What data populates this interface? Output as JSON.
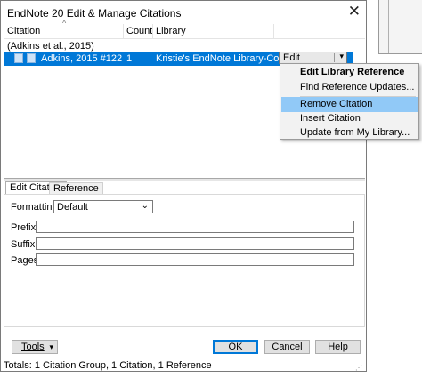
{
  "window": {
    "title": "EndNote 20 Edit & Manage Citations",
    "close_glyph": "✕"
  },
  "list": {
    "columns": [
      "Citation",
      "Count",
      "Library"
    ],
    "group_label": "(Adkins et al., 2015)",
    "rows": [
      {
        "citation": "Adkins, 2015 #122",
        "count": "1",
        "library": "Kristie's EndNote Library-Converted"
      }
    ],
    "edit_reference_button": "Edit Reference"
  },
  "menu": {
    "items": [
      {
        "label": "Edit Library Reference"
      },
      {
        "label": "Find Reference Updates..."
      },
      {
        "label": "Remove Citation"
      },
      {
        "label": "Insert Citation"
      },
      {
        "label": "Update from My Library..."
      }
    ]
  },
  "tabs": {
    "edit_citation": "Edit Citation",
    "reference": "Reference"
  },
  "edit": {
    "formatting_label": "Formatting:",
    "formatting_value": "Default",
    "prefix_label": "Prefix:",
    "suffix_label": "Suffix:",
    "pages_label": "Pages:"
  },
  "buttons": {
    "tools": "Tools",
    "ok": "OK",
    "cancel": "Cancel",
    "help": "Help"
  },
  "status": "Totals: 1 Citation Group, 1 Citation, 1 Reference",
  "colors": {
    "selection": "#0078d7",
    "menu_highlight": "#91c9f7"
  },
  "icons": [
    "close-icon",
    "sort-up-icon",
    "move-up-icon",
    "move-down-icon",
    "dropdown-arrow-icon",
    "chevron-down-icon",
    "resize-grip-icon"
  ]
}
